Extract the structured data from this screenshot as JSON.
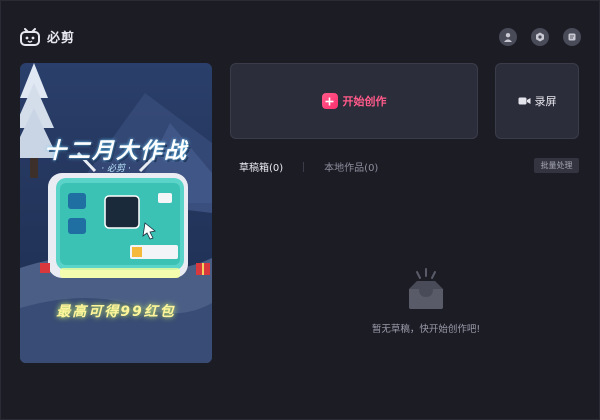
{
  "app": {
    "title": "必剪"
  },
  "header": {
    "icons": [
      {
        "name": "user-icon"
      },
      {
        "name": "settings-icon"
      },
      {
        "name": "message-icon"
      }
    ]
  },
  "banner": {
    "title": "十二月大作战",
    "subtitle": "· 必剪 ·",
    "footer": "最高可得99红包"
  },
  "actions": {
    "create_label": "开始创作",
    "record_label": "录屏"
  },
  "tabs": [
    {
      "label": "草稿箱(0)",
      "active": true
    },
    {
      "label": "本地作品(0)",
      "active": false
    }
  ],
  "batch_label": "批量处理",
  "empty": {
    "message": "暂无草稿，快开始创作吧!"
  },
  "colors": {
    "accent": "#ff5a8a",
    "background": "#1c1c25",
    "card": "#2c2d3a"
  }
}
